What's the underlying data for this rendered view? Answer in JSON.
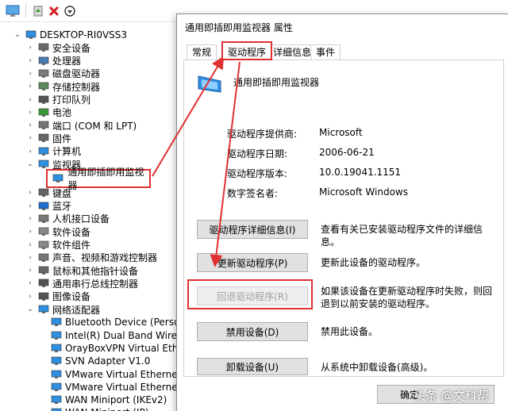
{
  "toolbar": {
    "icons": [
      "properties-icon",
      "enable-device-icon",
      "uninstall-icon",
      "update-driver-icon"
    ]
  },
  "tree": {
    "root": "DESKTOP-RI0VSS3",
    "categories": [
      {
        "label": "安全设备",
        "icon": "security-device-icon"
      },
      {
        "label": "处理器",
        "icon": "processor-icon"
      },
      {
        "label": "磁盘驱动器",
        "icon": "disk-drive-icon"
      },
      {
        "label": "存储控制器",
        "icon": "storage-controller-icon"
      },
      {
        "label": "打印队列",
        "icon": "printer-icon"
      },
      {
        "label": "电池",
        "icon": "battery-icon"
      },
      {
        "label": "端口 (COM 和 LPT)",
        "icon": "port-icon"
      },
      {
        "label": "固件",
        "icon": "firmware-icon"
      },
      {
        "label": "计算机",
        "icon": "computer-icon"
      },
      {
        "label": "监视器",
        "icon": "monitor-icon"
      }
    ],
    "selected_child": "通用即插即用监视器",
    "categories_after": [
      {
        "label": "键盘",
        "icon": "keyboard-icon"
      },
      {
        "label": "蓝牙",
        "icon": "bluetooth-icon"
      },
      {
        "label": "人机接口设备",
        "icon": "hid-icon"
      },
      {
        "label": "软件设备",
        "icon": "software-device-icon"
      },
      {
        "label": "软件组件",
        "icon": "software-component-icon"
      },
      {
        "label": "声音、视频和游戏控制器",
        "icon": "sound-icon"
      },
      {
        "label": "鼠标和其他指针设备",
        "icon": "mouse-icon"
      },
      {
        "label": "通用串行总线控制器",
        "icon": "usb-icon"
      },
      {
        "label": "图像设备",
        "icon": "camera-icon"
      },
      {
        "label": "网络适配器",
        "icon": "network-adapter-icon"
      }
    ],
    "network_children": [
      "Bluetooth Device (Personal A",
      "Intel(R) Dual Band Wireless-",
      "OrayBoxVPN Virtual Etherne",
      "SVN Adapter V1.0",
      "VMware Virtual Ethernet Ada",
      "VMware Virtual Ethernet Ada",
      "WAN Miniport (IKEv2)",
      "WAN Miniport (IP)"
    ]
  },
  "dialog": {
    "title": "通用即插即用监视器 属性",
    "tabs": [
      "常规",
      "驱动程序",
      "详细信息",
      "事件"
    ],
    "active_tab": "驱动程序",
    "device_name": "通用即插即用监视器",
    "info": [
      {
        "key": "驱动程序提供商:",
        "value": "Microsoft"
      },
      {
        "key": "驱动程序日期:",
        "value": "2006-06-21"
      },
      {
        "key": "驱动程序版本:",
        "value": "10.0.19041.1151"
      },
      {
        "key": "数字签名者:",
        "value": "Microsoft Windows"
      }
    ],
    "buttons": [
      {
        "label": "驱动程序详细信息(I)",
        "desc": "查看有关已安装驱动程序文件的详细信息。",
        "enabled": true
      },
      {
        "label": "更新驱动程序(P)",
        "desc": "更新此设备的驱动程序。",
        "enabled": true
      },
      {
        "label": "回退驱动程序(R)",
        "desc": "如果该设备在更新驱动程序时失败，则回退到以前安装的驱动程序。",
        "enabled": false
      },
      {
        "label": "禁用设备(D)",
        "desc": "禁用此设备。",
        "enabled": true
      },
      {
        "label": "卸载设备(U)",
        "desc": "从系统中卸载设备(高级)。",
        "enabled": true
      }
    ],
    "ok_label": "确定",
    "watermark": "头条 @文科帮"
  },
  "colors": {
    "annotation_red": "#e03030",
    "selection_blue": "#0078d7"
  }
}
